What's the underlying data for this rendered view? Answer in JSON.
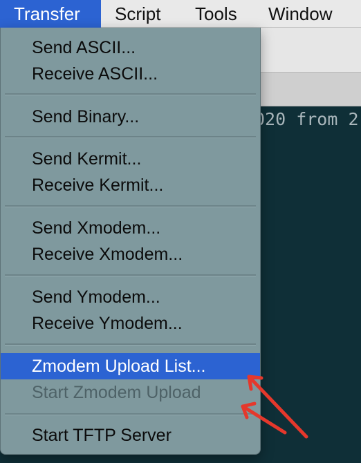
{
  "menubar": {
    "items": [
      {
        "label": "Transfer"
      },
      {
        "label": "Script"
      },
      {
        "label": "Tools"
      },
      {
        "label": "Window"
      }
    ]
  },
  "terminal": {
    "visible_text": "020 from 2"
  },
  "transfer_menu": {
    "items": [
      {
        "label": "Send ASCII..."
      },
      {
        "label": "Receive ASCII..."
      },
      {
        "label": "Send Binary..."
      },
      {
        "label": "Send Kermit..."
      },
      {
        "label": "Receive Kermit..."
      },
      {
        "label": "Send Xmodem..."
      },
      {
        "label": "Receive Xmodem..."
      },
      {
        "label": "Send Ymodem..."
      },
      {
        "label": "Receive Ymodem..."
      },
      {
        "label": "Zmodem Upload List...",
        "state": "highlighted"
      },
      {
        "label": "Start Zmodem Upload",
        "state": "disabled"
      },
      {
        "label": "Start TFTP Server"
      }
    ]
  },
  "colors": {
    "accent": "#2c63d2",
    "menu_background": "#7f999e",
    "terminal_background": "#0f2f37",
    "annotation_arrow": "#e5382c"
  }
}
